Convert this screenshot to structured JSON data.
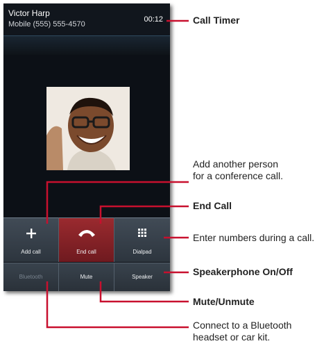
{
  "call": {
    "caller_name": "Victor Harp",
    "caller_number": "Mobile (555) 555-4570",
    "timer": "00:12"
  },
  "buttons": {
    "add_call": "Add call",
    "end_call": "End call",
    "dialpad": "Dialpad",
    "bluetooth": "Bluetooth",
    "mute": "Mute",
    "speaker": "Speaker"
  },
  "callouts": {
    "call_timer": "Call Timer",
    "add_person_line1": "Add another person",
    "add_person_line2": "for a conference call.",
    "end_call": "End Call",
    "dialpad": "Enter numbers during a call.",
    "speakerphone": "Speakerphone On/Off",
    "mute": "Mute/Unmute",
    "bluetooth_line1": "Connect to a Bluetooth",
    "bluetooth_line2": "headset or car kit."
  },
  "colors": {
    "callout_line": "#c8102e",
    "end_call_button": "#8b2329",
    "screen_background": "#0c1016"
  }
}
